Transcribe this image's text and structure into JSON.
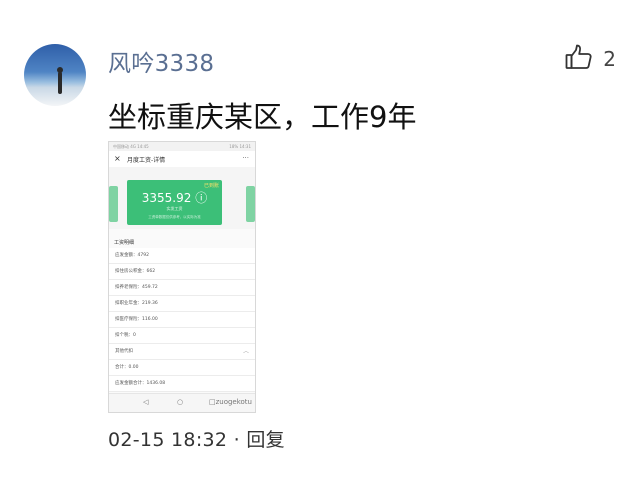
{
  "comment": {
    "username": "风吟3338",
    "likes": "2",
    "text": "坐标重庆某区，工作9年",
    "timestamp": "02-15 18:32",
    "separator": "·",
    "reply_label": "回复"
  },
  "screenshot": {
    "status_left": "中国移动 4G 14:45",
    "status_right": "18% 14:31",
    "title": "月度工资-详情",
    "close_glyph": "×",
    "more_glyph": "···",
    "card_tag": "已到账",
    "amount": "3355.92 ⓘ",
    "card_sub": "实发工资",
    "card_note": "工资单数据仅供参考，以实际为准",
    "section_title": "工资明细",
    "rows": [
      {
        "label": "应发金额：4792"
      },
      {
        "label": "扣住房公积金：662"
      },
      {
        "label": "扣养老保险：459.72"
      },
      {
        "label": "扣职业年金：219.36"
      },
      {
        "label": "扣医疗保险：116.00"
      },
      {
        "label": "扣个税：0"
      },
      {
        "label": "其他代扣"
      },
      {
        "label": "合计：0.00"
      },
      {
        "label": "应发金额合计：1436.08"
      }
    ],
    "expand_row_chevron": "︿",
    "nav_back": "◁",
    "nav_home": "○",
    "nav_recent": "□",
    "watermark": "zuogekotu"
  },
  "colors": {
    "username": "#5a6f92",
    "card_green": "#3cbf78"
  }
}
